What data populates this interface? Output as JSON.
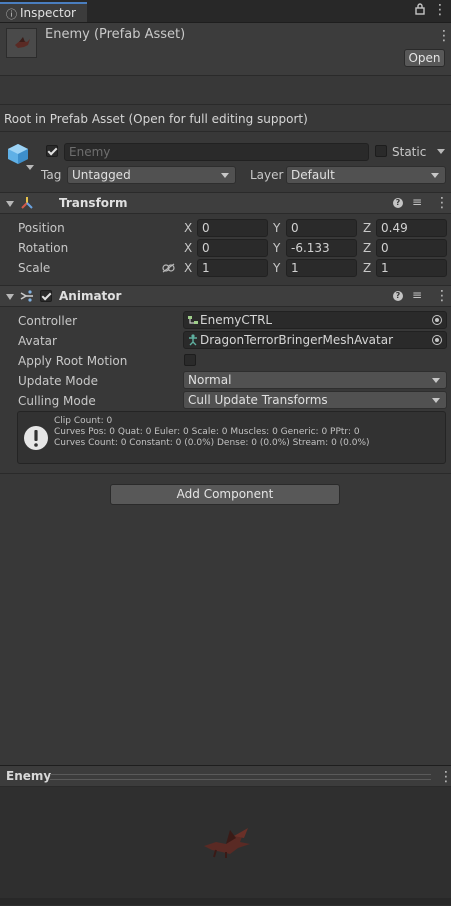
{
  "tab": {
    "title": "Inspector"
  },
  "header": {
    "object_title": "Enemy (Prefab Asset)",
    "open_button": "Open",
    "root_notice": "Root in Prefab Asset (Open for full editing support)"
  },
  "gameobject": {
    "name_value": "Enemy",
    "static_label": "Static",
    "tag_label": "Tag",
    "tag_value": "Untagged",
    "layer_label": "Layer",
    "layer_value": "Default"
  },
  "transform": {
    "title": "Transform",
    "position_label": "Position",
    "rotation_label": "Rotation",
    "scale_label": "Scale",
    "axis_x": "X",
    "axis_y": "Y",
    "axis_z": "Z",
    "position": {
      "x": "0",
      "y": "0",
      "z": "0.49"
    },
    "rotation": {
      "x": "0",
      "y": "-6.133",
      "z": "0"
    },
    "scale": {
      "x": "1",
      "y": "1",
      "z": "1"
    }
  },
  "animator": {
    "title": "Animator",
    "controller_label": "Controller",
    "controller_value": "EnemyCTRL",
    "avatar_label": "Avatar",
    "avatar_value": "DragonTerrorBringerMeshAvatar",
    "apply_root_motion_label": "Apply Root Motion",
    "update_mode_label": "Update Mode",
    "update_mode_value": "Normal",
    "culling_mode_label": "Culling Mode",
    "culling_mode_value": "Cull Update Transforms",
    "info_line1": "Clip Count: 0",
    "info_line2": "Curves Pos: 0 Quat: 0 Euler: 0 Scale: 0 Muscles: 0 Generic: 0 PPtr: 0",
    "info_line3": "Curves Count: 0 Constant: 0 (0.0%) Dense: 0 (0.0%) Stream: 0 (0.0%)"
  },
  "add_component_label": "Add Component",
  "preview": {
    "title": "Enemy"
  },
  "colors": {
    "background": "#383838",
    "accent": "#4a7ebf",
    "field": "#2a2a2a"
  }
}
